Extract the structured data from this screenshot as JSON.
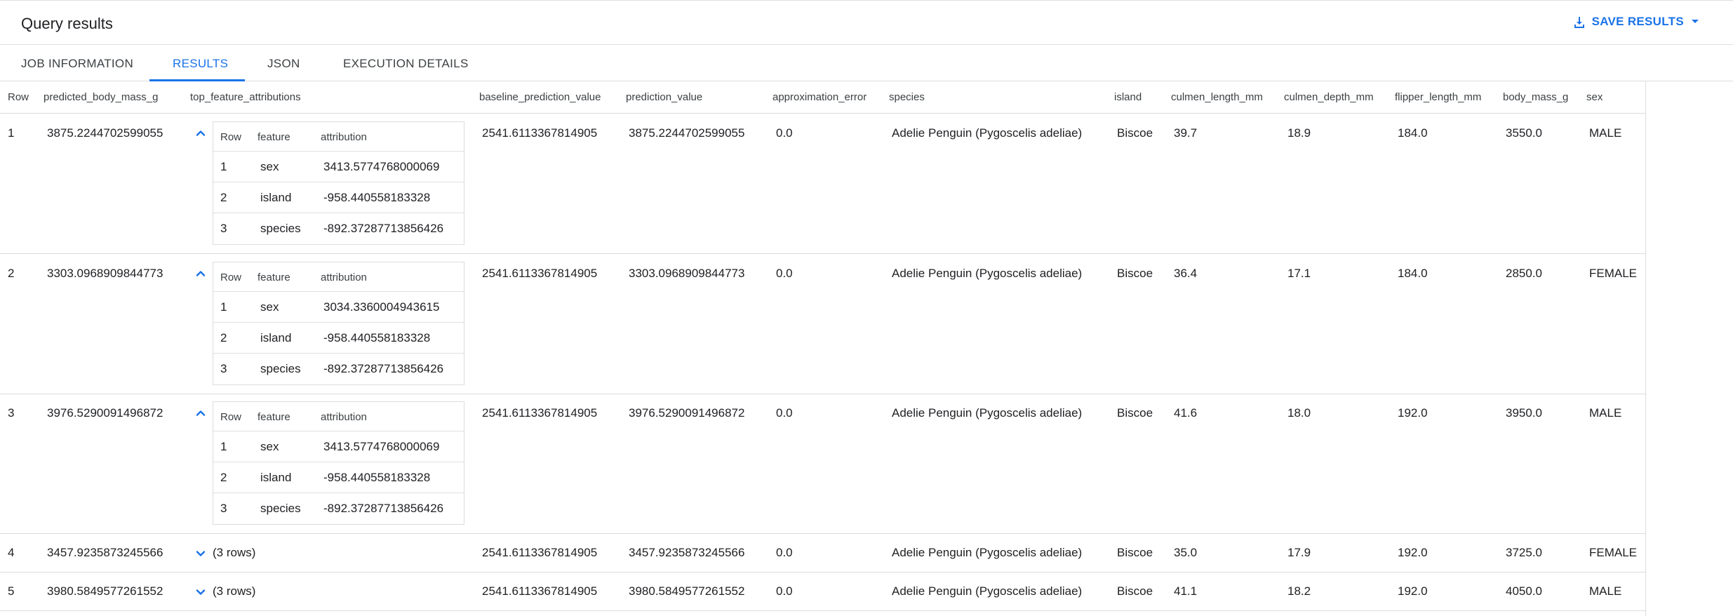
{
  "header": {
    "title": "Query results",
    "save_label": "SAVE RESULTS"
  },
  "tabs": [
    {
      "label": "JOB INFORMATION",
      "active": false
    },
    {
      "label": "RESULTS",
      "active": true
    },
    {
      "label": "JSON",
      "active": false
    },
    {
      "label": "EXECUTION DETAILS",
      "active": false
    }
  ],
  "columns": {
    "row": "Row",
    "predicted_body_mass_g": "predicted_body_mass_g",
    "top_feature_attributions": "top_feature_attributions",
    "baseline_prediction_value": "baseline_prediction_value",
    "prediction_value": "prediction_value",
    "approximation_error": "approximation_error",
    "species": "species",
    "island": "island",
    "culmen_length_mm": "culmen_length_mm",
    "culmen_depth_mm": "culmen_depth_mm",
    "flipper_length_mm": "flipper_length_mm",
    "body_mass_g": "body_mass_g",
    "sex": "sex"
  },
  "nested_columns": {
    "row": "Row",
    "feature": "feature",
    "attribution": "attribution"
  },
  "collapsed_label": "(3 rows)",
  "accent_color": "#1a73e8",
  "rows": [
    {
      "row": "1",
      "predicted_body_mass_g": "3875.2244702599055",
      "baseline_prediction_value": "2541.6113367814905",
      "prediction_value": "3875.2244702599055",
      "approximation_error": "0.0",
      "species": "Adelie Penguin (Pygoscelis adeliae)",
      "island": "Biscoe",
      "culmen_length_mm": "39.7",
      "culmen_depth_mm": "18.9",
      "flipper_length_mm": "184.0",
      "body_mass_g": "3550.0",
      "sex": "MALE",
      "attributions": [
        {
          "row": "1",
          "feature": "sex",
          "attribution": "3413.5774768000069"
        },
        {
          "row": "2",
          "feature": "island",
          "attribution": "-958.440558183328"
        },
        {
          "row": "3",
          "feature": "species",
          "attribution": "-892.37287713856426"
        }
      ]
    },
    {
      "row": "2",
      "predicted_body_mass_g": "3303.0968909844773",
      "baseline_prediction_value": "2541.6113367814905",
      "prediction_value": "3303.0968909844773",
      "approximation_error": "0.0",
      "species": "Adelie Penguin (Pygoscelis adeliae)",
      "island": "Biscoe",
      "culmen_length_mm": "36.4",
      "culmen_depth_mm": "17.1",
      "flipper_length_mm": "184.0",
      "body_mass_g": "2850.0",
      "sex": "FEMALE",
      "attributions": [
        {
          "row": "1",
          "feature": "sex",
          "attribution": "3034.3360004943615"
        },
        {
          "row": "2",
          "feature": "island",
          "attribution": "-958.440558183328"
        },
        {
          "row": "3",
          "feature": "species",
          "attribution": "-892.37287713856426"
        }
      ]
    },
    {
      "row": "3",
      "predicted_body_mass_g": "3976.5290091496872",
      "baseline_prediction_value": "2541.6113367814905",
      "prediction_value": "3976.5290091496872",
      "approximation_error": "0.0",
      "species": "Adelie Penguin (Pygoscelis adeliae)",
      "island": "Biscoe",
      "culmen_length_mm": "41.6",
      "culmen_depth_mm": "18.0",
      "flipper_length_mm": "192.0",
      "body_mass_g": "3950.0",
      "sex": "MALE",
      "attributions": [
        {
          "row": "1",
          "feature": "sex",
          "attribution": "3413.5774768000069"
        },
        {
          "row": "2",
          "feature": "island",
          "attribution": "-958.440558183328"
        },
        {
          "row": "3",
          "feature": "species",
          "attribution": "-892.37287713856426"
        }
      ]
    },
    {
      "row": "4",
      "predicted_body_mass_g": "3457.9235873245566",
      "baseline_prediction_value": "2541.6113367814905",
      "prediction_value": "3457.9235873245566",
      "approximation_error": "0.0",
      "species": "Adelie Penguin (Pygoscelis adeliae)",
      "island": "Biscoe",
      "culmen_length_mm": "35.0",
      "culmen_depth_mm": "17.9",
      "flipper_length_mm": "192.0",
      "body_mass_g": "3725.0",
      "sex": "FEMALE"
    },
    {
      "row": "5",
      "predicted_body_mass_g": "3980.5849577261552",
      "baseline_prediction_value": "2541.6113367814905",
      "prediction_value": "3980.5849577261552",
      "approximation_error": "0.0",
      "species": "Adelie Penguin (Pygoscelis adeliae)",
      "island": "Biscoe",
      "culmen_length_mm": "41.1",
      "culmen_depth_mm": "18.2",
      "flipper_length_mm": "192.0",
      "body_mass_g": "4050.0",
      "sex": "MALE"
    }
  ]
}
